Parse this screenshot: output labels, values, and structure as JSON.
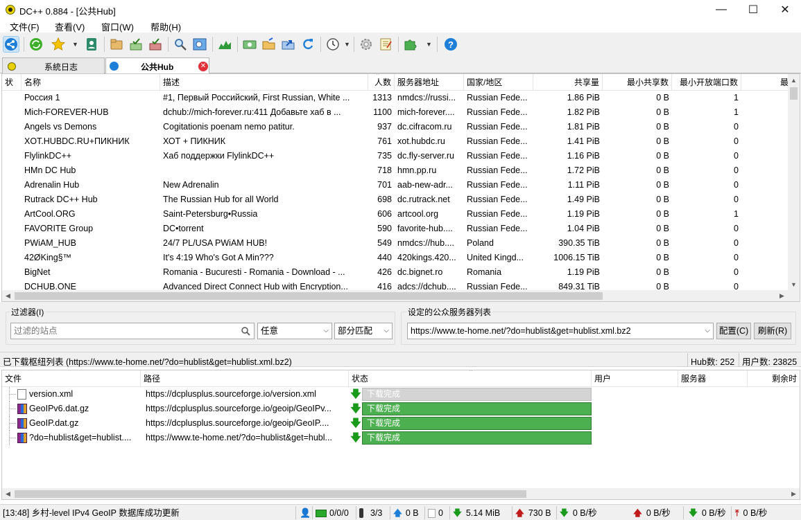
{
  "window": {
    "title": "DC++ 0.884 - [公共Hub]",
    "minimize": "—",
    "maximize": "☐",
    "close": "✕"
  },
  "menu": [
    "文件(F)",
    "查看(V)",
    "窗口(W)",
    "帮助(H)"
  ],
  "tabs": [
    {
      "label": "系統日志"
    },
    {
      "label": "公共Hub"
    }
  ],
  "hub_table": {
    "columns": [
      "状",
      "名称",
      "描述",
      "人数",
      "服务器地址",
      "国家/地区",
      "共享量",
      "最小共享数",
      "最小开放端口数",
      "最大"
    ],
    "rows": [
      [
        "Россия 1",
        "#1, Первый Российский, First Russian, White ...",
        "1313",
        "nmdcs://russi...",
        "Russian Fede...",
        "1.86 PiB",
        "0 B",
        "1"
      ],
      [
        "Mich-FOREVER-HUB",
        "dchub://mich-forever.ru:411 Добавьте хаб в ...",
        "1100",
        "mich-forever....",
        "Russian Fede...",
        "1.82 PiB",
        "0 B",
        "1"
      ],
      [
        "Angels vs Demons",
        "Cogitationis poenam nemo patitur.",
        "937",
        "dc.cifracom.ru",
        "Russian Fede...",
        "1.81 PiB",
        "0 B",
        "0"
      ],
      [
        "XOT.HUBDC.RU+ПИКНИК",
        "ХОТ + ПИКНИК",
        "761",
        "xot.hubdc.ru",
        "Russian Fede...",
        "1.41 PiB",
        "0 B",
        "0"
      ],
      [
        "FlylinkDC++",
        "Хаб поддержки FlylinkDC++",
        "735",
        "dc.fly-server.ru",
        "Russian Fede...",
        "1.16 PiB",
        "0 B",
        "0"
      ],
      [
        "HMn DC Hub",
        "",
        "718",
        "hmn.pp.ru",
        "Russian Fede...",
        "1.72 PiB",
        "0 B",
        "0"
      ],
      [
        "Adrenalin Hub",
        "New Adrenalin",
        "701",
        "aab-new-adr...",
        "Russian Fede...",
        "1.11 PiB",
        "0 B",
        "0"
      ],
      [
        "Rutrack DC++ Hub",
        "The Russian Hub for all World",
        "698",
        "dc.rutrack.net",
        "Russian Fede...",
        "1.49 PiB",
        "0 B",
        "0"
      ],
      [
        "ArtCool.ORG",
        "Saint-Petersburg•Russia",
        "606",
        "artcool.org",
        "Russian Fede...",
        "1.19 PiB",
        "0 B",
        "1"
      ],
      [
        "FAVORITE Group",
        "DC•torrent",
        "590",
        "favorite-hub....",
        "Russian Fede...",
        "1.04 PiB",
        "0 B",
        "0"
      ],
      [
        "PWiAM_HUB",
        "24/7 PL/USA PWiAM HUB!",
        "549",
        "nmdcs://hub....",
        "Poland",
        "390.35 TiB",
        "0 B",
        "0"
      ],
      [
        "42ØKing§™",
        "It's 4:19 Who's Got A Min???",
        "440",
        "420kings.420...",
        "United Kingd...",
        "1006.15 TiB",
        "0 B",
        "0"
      ],
      [
        "BigNet",
        "Romania - Bucuresti - Romania - Download - ...",
        "426",
        "dc.bignet.ro",
        "Romania",
        "1.19 PiB",
        "0 B",
        "0"
      ],
      [
        "DCHUB.ONE",
        "Advanced Direct Connect Hub with Encryption...",
        "416",
        "adcs://dchub....",
        "Russian Fede...",
        "849.31 TiB",
        "0 B",
        "0"
      ]
    ]
  },
  "filter": {
    "group_label": "过滤器(I)",
    "placeholder": "过滤的站点",
    "field_select": "任意",
    "match_select": "部分匹配"
  },
  "hublists": {
    "group_label": "设定的公众服务器列表",
    "selected": "https://www.te-home.net/?do=hublist&get=hublist.xml.bz2",
    "configure_label": "配置(C)",
    "refresh_label": "刷新(R)"
  },
  "status_line": {
    "message": "已下载枢纽列表 (https://www.te-home.net/?do=hublist&get=hublist.xml.bz2)",
    "hub_count": "Hub数: 252",
    "user_count": "用户数: 23825"
  },
  "downloads": {
    "columns": [
      "文件",
      "路径",
      "状态",
      "用户",
      "服务器",
      "剩余时"
    ],
    "rows": [
      {
        "file": "version.xml",
        "path": "https://dcplusplus.sourceforge.io/version.xml",
        "status": "下载完成",
        "style": "gray"
      },
      {
        "file": "GeoIPv6.dat.gz",
        "path": "https://dcplusplus.sourceforge.io/geoip/GeoIPv...",
        "status": "下载完成",
        "style": "green"
      },
      {
        "file": "GeoIP.dat.gz",
        "path": "https://dcplusplus.sourceforge.io/geoip/GeoIP....",
        "status": "下载完成",
        "style": "green"
      },
      {
        "file": "?do=hublist&get=hublist....",
        "path": "https://www.te-home.net/?do=hublist&get=hubl...",
        "status": "下载完成",
        "style": "green"
      }
    ]
  },
  "statusbar": {
    "log": "[13:48] 乡村-level IPv4 GeoIP 数据库成功更新",
    "hubs": "0/0/0",
    "slots": "3/3",
    "upload_queue": "0 B",
    "download_queue": "0",
    "downloaded": "5.14 MiB",
    "uploaded": "730 B",
    "dl_speed": "0 B/秒",
    "ul_speed": "0 B/秒",
    "dl_speed2": "0 B/秒",
    "ul_speed2": "0 B/秒"
  },
  "colors": {
    "accent": "#0078d7",
    "progress": "#4caf50",
    "progress_gray": "#d4d4d4"
  }
}
